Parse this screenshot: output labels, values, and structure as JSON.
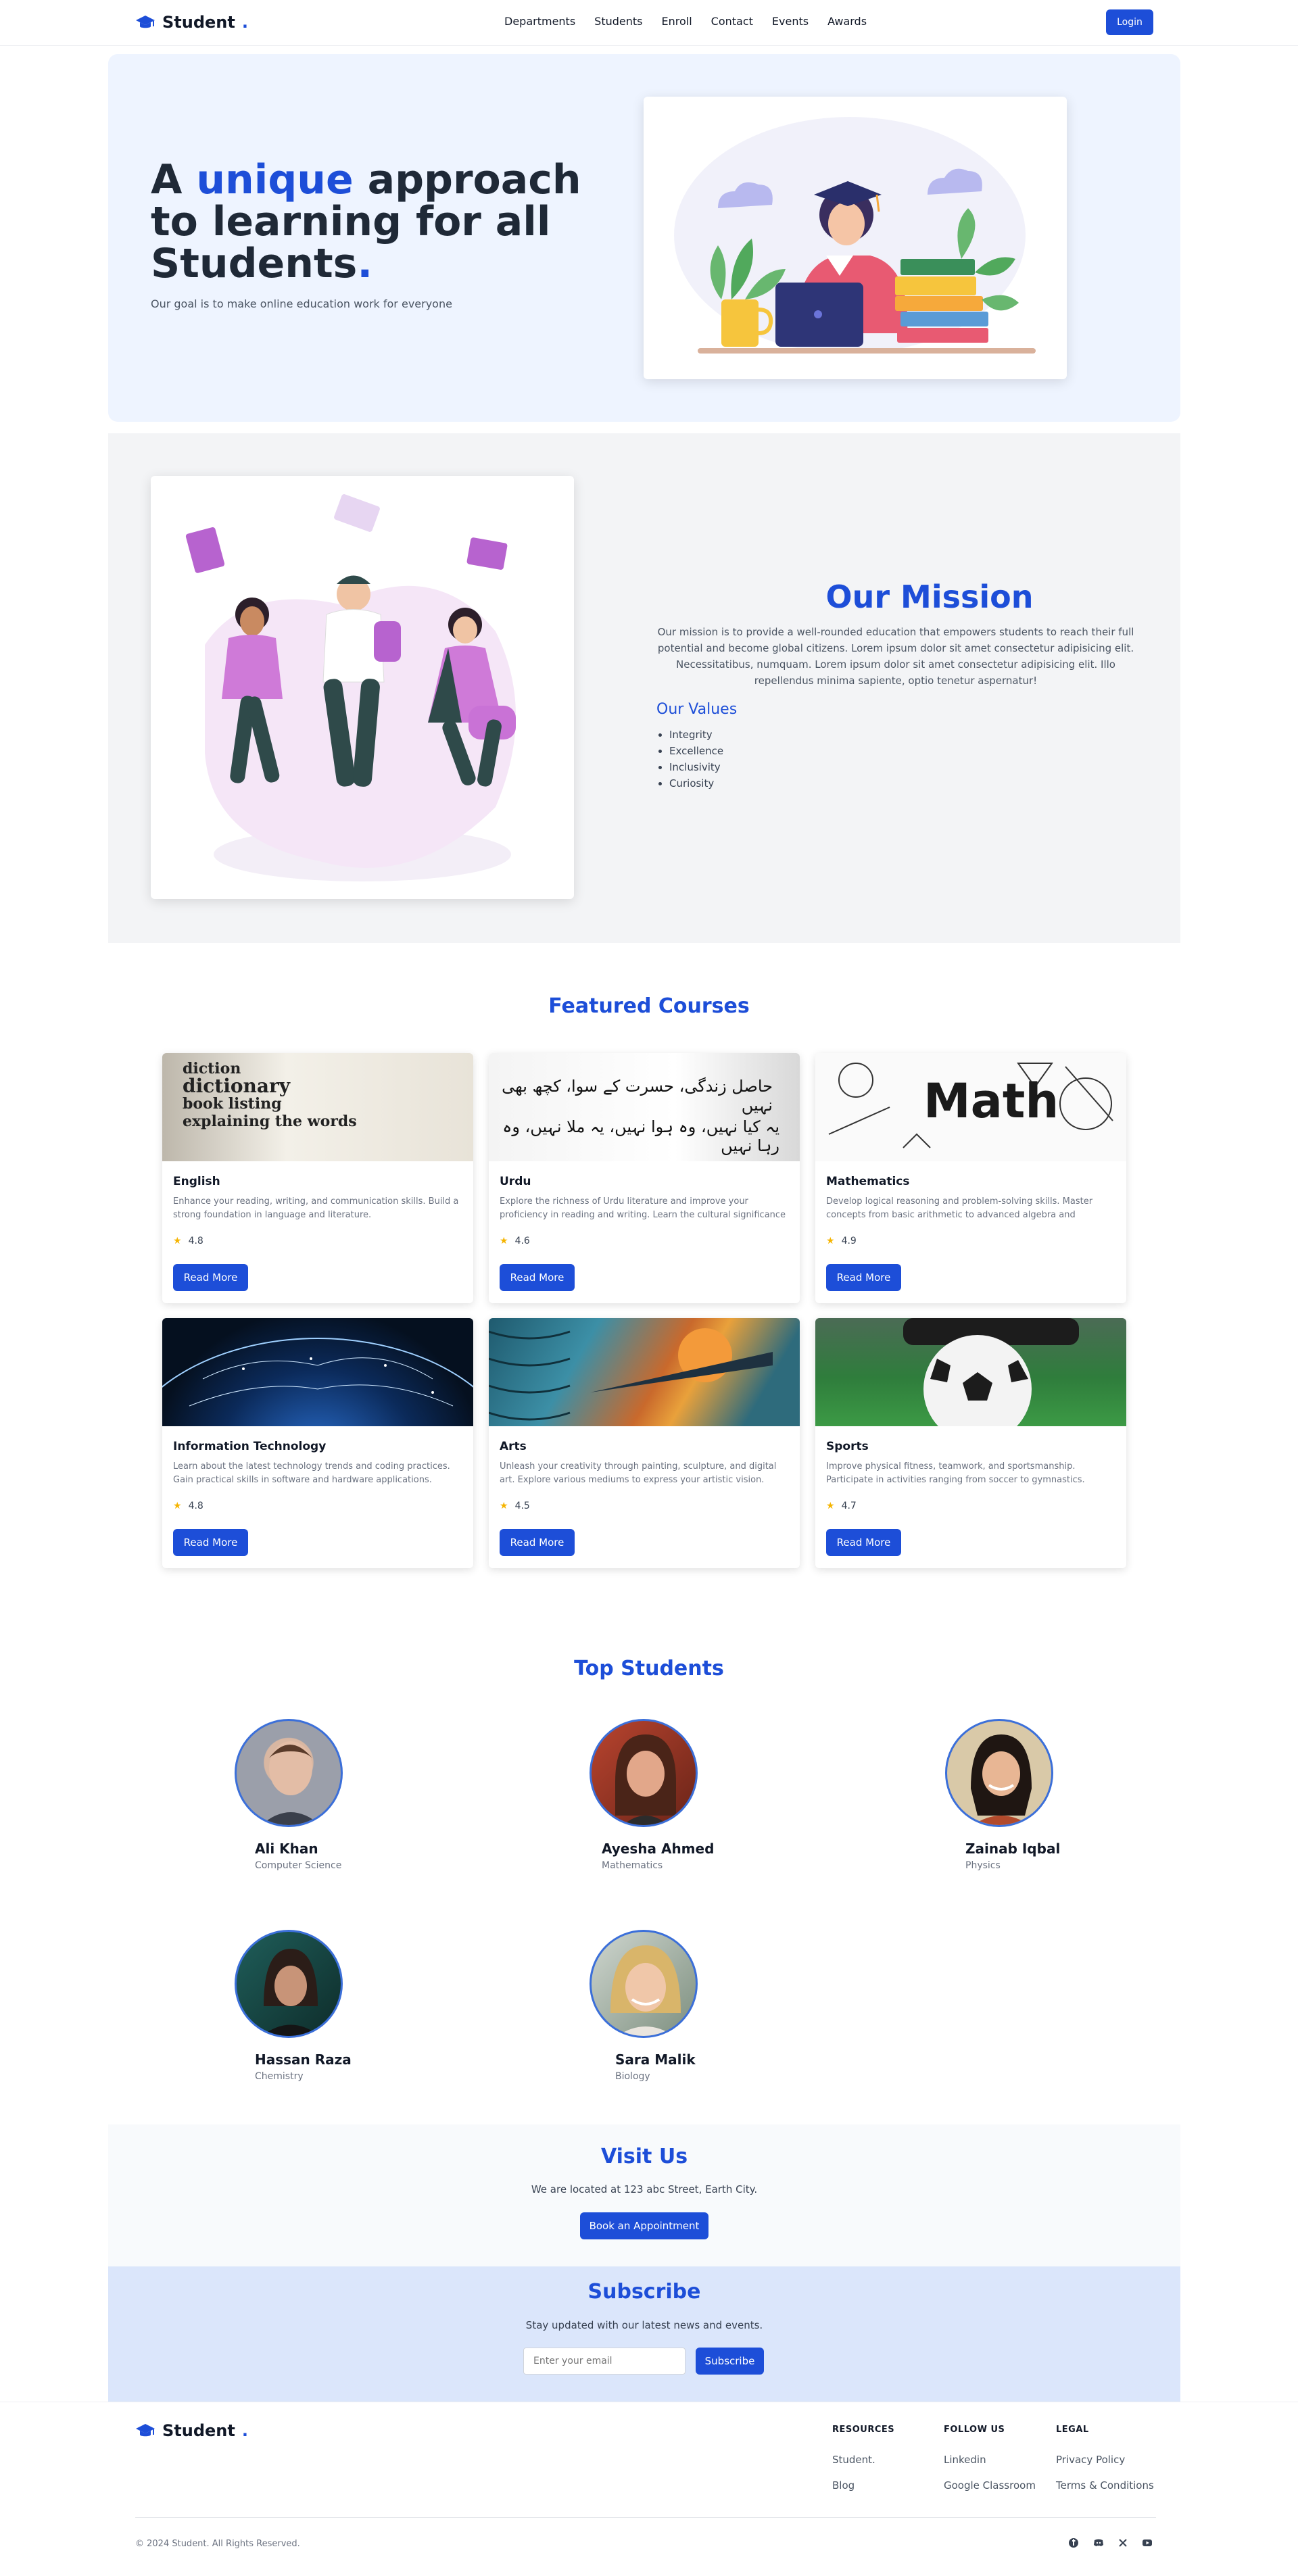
{
  "brand": {
    "name": "Student",
    "dot": "."
  },
  "nav": {
    "links": [
      "Departments",
      "Students",
      "Enroll",
      "Contact",
      "Events",
      "Awards"
    ],
    "login": "Login"
  },
  "hero": {
    "title_a": "A ",
    "title_accent": "unique",
    "title_b": " approach to learning for all Students",
    "title_dot": ".",
    "subtitle": "Our goal is to make online education work for everyone"
  },
  "mission": {
    "title": "Our Mission",
    "text": "Our mission is to provide a well-rounded education that empowers students to reach their full potential and become global citizens. Lorem ipsum dolor sit amet consectetur adipisicing elit. Necessitatibus, numquam. Lorem ipsum dolor sit amet consectetur adipisicing elit. Illo repellendus minima sapiente, optio tenetur aspernatur!",
    "values_title": "Our Values",
    "values": [
      "Integrity",
      "Excellence",
      "Inclusivity",
      "Curiosity"
    ]
  },
  "courses": {
    "title": "Featured Courses",
    "read_more": "Read More",
    "items": [
      {
        "name": "English",
        "desc": "Enhance your reading, writing, and communication skills. Build a strong foundation in language and literature.",
        "rating": "4.8"
      },
      {
        "name": "Urdu",
        "desc": "Explore the richness of Urdu literature and improve your proficiency in reading and writing. Learn the cultural significance of the...",
        "rating": "4.6"
      },
      {
        "name": "Mathematics",
        "desc": "Develop logical reasoning and problem-solving skills. Master concepts from basic arithmetic to advanced algebra and geometry.",
        "rating": "4.9"
      },
      {
        "name": "Information Technology",
        "desc": "Learn about the latest technology trends and coding practices. Gain practical skills in software and hardware applications.",
        "rating": "4.8"
      },
      {
        "name": "Arts",
        "desc": "Unleash your creativity through painting, sculpture, and digital art. Explore various mediums to express your artistic vision.",
        "rating": "4.5"
      },
      {
        "name": "Sports",
        "desc": "Improve physical fitness, teamwork, and sportsmanship. Participate in activities ranging from soccer to gymnastics.",
        "rating": "4.7"
      }
    ],
    "thumb_text": {
      "english": [
        "diction",
        "dictionary",
        "book listing",
        "explaining the words"
      ],
      "urdu": [
        "حاصل زندگی، حسرت کے سوا، کچھ بھی نہیں",
        "یہ کیا نہیں، وہ ہوا نہیں، یہ ملا نہیں، وہ رہا نہیں"
      ],
      "math": "Math"
    }
  },
  "students": {
    "title": "Top Students",
    "items": [
      {
        "name": "Ali Khan",
        "subject": "Computer Science"
      },
      {
        "name": "Ayesha Ahmed",
        "subject": "Mathematics"
      },
      {
        "name": "Zainab Iqbal",
        "subject": "Physics"
      },
      {
        "name": "Hassan Raza",
        "subject": "Chemistry"
      },
      {
        "name": "Sara Malik",
        "subject": "Biology"
      }
    ]
  },
  "visit": {
    "title": "Visit Us",
    "text": "We are located at 123 abc Street, Earth City.",
    "button": "Book an Appointment"
  },
  "subscribe": {
    "title": "Subscribe",
    "text": "Stay updated with our latest news and events.",
    "placeholder": "Enter your email",
    "button": "Subscribe"
  },
  "footer": {
    "resources": {
      "title": "RESOURCES",
      "links": [
        "Student.",
        "Blog"
      ]
    },
    "follow": {
      "title": "FOLLOW US",
      "links": [
        "Linkedin",
        "Google Classroom"
      ]
    },
    "legal": {
      "title": "LEGAL",
      "links": [
        "Privacy Policy",
        "Terms & Conditions"
      ]
    },
    "copyright": "© 2024 Student. All Rights Reserved.",
    "social_icons": [
      "facebook-icon",
      "discord-icon",
      "x-icon",
      "youtube-icon"
    ]
  },
  "colors": {
    "accent": "#1d4ed8",
    "hero_bg": "#eef4ff",
    "mission_bg": "#f3f4f6",
    "subscribe_bg": "#dbe6fb",
    "star": "#f5b400"
  }
}
